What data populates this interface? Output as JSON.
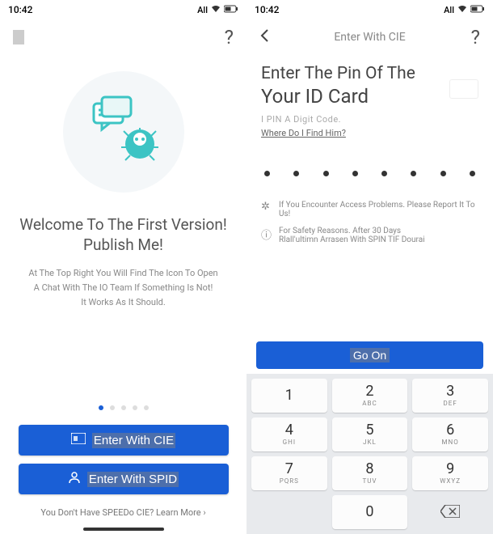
{
  "status": {
    "time": "10:42",
    "network_label": "All",
    "wifi_icon": "wifi-icon",
    "battery_icon": "battery-icon"
  },
  "left": {
    "welcome_title_line1": "Welcome To The First Version!",
    "welcome_title_line2": "Publish Me!",
    "desc_line1": "At The Top Right You Will Find The Icon To Open",
    "desc_line2": "A Chat With The IO Team If Something Is Not!",
    "desc_line3": "It Works As It Should.",
    "btn_cie": "Enter With CIE",
    "btn_spid": "Enter With SPID",
    "learn_more": "You Don't Have SPEEDo CIE? Learn More ›"
  },
  "right": {
    "header_title": "Enter With CIE",
    "title_line1": "Enter The Pin Of The",
    "title_line2": "Your ID Card",
    "subtitle": "I PIN A Digit Code.",
    "find_link": "Where Do I Find Him?",
    "pin_length": 8,
    "info_bug": "If You Encounter Access Problems. Please Report It To Us!",
    "info_safety_line1": "For Safety Reasons. After 30 Days",
    "info_safety_line2": "Rlall'ultimn Arrasen With SPIN TIF Dourai",
    "go_label": "Go On",
    "keypad": [
      {
        "num": "1",
        "sub": ""
      },
      {
        "num": "2",
        "sub": "ABC"
      },
      {
        "num": "3",
        "sub": "DEF"
      },
      {
        "num": "4",
        "sub": "GHI"
      },
      {
        "num": "5",
        "sub": "JKL"
      },
      {
        "num": "6",
        "sub": "MNO"
      },
      {
        "num": "7",
        "sub": "PQRS"
      },
      {
        "num": "8",
        "sub": "TUV"
      },
      {
        "num": "9",
        "sub": "WXYZ"
      },
      {
        "num": "0",
        "sub": ""
      }
    ]
  }
}
